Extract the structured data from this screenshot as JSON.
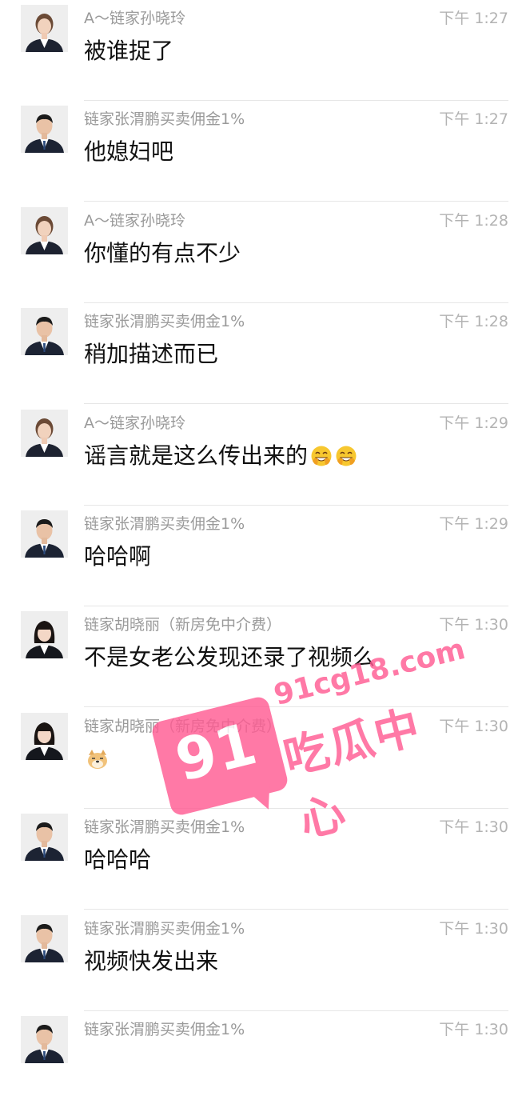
{
  "messages": [
    {
      "sender": "A～链家孙晓玲",
      "time": "下午 1:27",
      "text": "被谁捉了",
      "avatar": "female-agent-avatar",
      "emoji": []
    },
    {
      "sender": "链家张渭鹏买卖佣金1%",
      "time": "下午 1:27",
      "text": "他媳妇吧",
      "avatar": "male-agent-avatar",
      "emoji": []
    },
    {
      "sender": "A～链家孙晓玲",
      "time": "下午 1:28",
      "text": "你懂的有点不少",
      "avatar": "female-agent-avatar",
      "emoji": []
    },
    {
      "sender": "链家张渭鹏买卖佣金1%",
      "time": "下午 1:28",
      "text": "稍加描述而已",
      "avatar": "male-agent-avatar",
      "emoji": []
    },
    {
      "sender": "A～链家孙晓玲",
      "time": "下午 1:29",
      "text": "谣言就是这么传出来的",
      "avatar": "female-agent-avatar",
      "emoji": [
        "facepalm-grin-emoji",
        "facepalm-grin-emoji"
      ]
    },
    {
      "sender": "链家张渭鹏买卖佣金1%",
      "time": "下午 1:29",
      "text": "哈哈啊",
      "avatar": "male-agent-avatar",
      "emoji": []
    },
    {
      "sender": "链家胡晓丽（新房免中介费）",
      "time": "下午 1:30",
      "text": "不是女老公发现还录了视频么",
      "avatar": "female-agent-avatar-2",
      "emoji": []
    },
    {
      "sender": "链家胡晓丽（新房免中介费）",
      "time": "下午 1:30",
      "text": "",
      "avatar": "female-agent-avatar-2",
      "emoji": [
        "doge-emoji"
      ]
    },
    {
      "sender": "链家张渭鹏买卖佣金1%",
      "time": "下午 1:30",
      "text": "哈哈哈",
      "avatar": "male-agent-avatar",
      "emoji": []
    },
    {
      "sender": "链家张渭鹏买卖佣金1%",
      "time": "下午 1:30",
      "text": "视频快发出来",
      "avatar": "male-agent-avatar",
      "emoji": []
    },
    {
      "sender": "链家张渭鹏买卖佣金1%",
      "time": "下午 1:30",
      "text": "",
      "avatar": "male-agent-avatar",
      "emoji": []
    }
  ],
  "watermark": {
    "number": "91",
    "domain": "91cg18.com",
    "brand": "吃瓜中心"
  },
  "colors": {
    "watermark_pink": "#ff5c93",
    "sender_gray": "#9a9a9a",
    "time_gray": "#b3b3b3",
    "divider": "#e6e6e6"
  }
}
